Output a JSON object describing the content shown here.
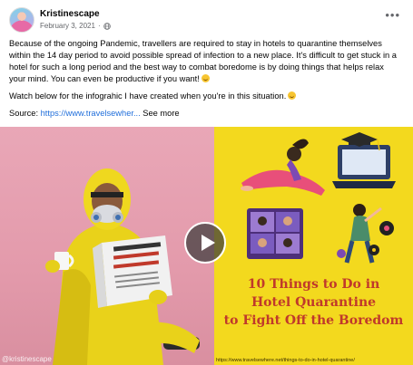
{
  "post": {
    "author": "Kristinescape",
    "date": "February 3, 2021",
    "dot": "·",
    "more_icon": "more-horizontal-icon",
    "body": {
      "paragraph1": "Because of  the ongoing Pandemic, travellers are required to stay in hotels to quarantine themselves within the 14 day period to avoid possible spread of infection to a new place. It's difficult to get stuck in a hotel for such a long period and the best way to combat boredome is by doing things that helps relax your mind. You can even be productive if you want!",
      "paragraph2": "Watch below for the infograhic I have created when you're in this situation.",
      "source_label": "Source:",
      "source_link": "https://www.travelsewher...",
      "see_more": "See more"
    }
  },
  "media": {
    "watermark": "@kristinescape",
    "url_caption": "https://www.travelsewhere.net/things-to-do-in-hotel-quarantine/",
    "headline_line1": "10 Things to Do in",
    "headline_line2": "Hotel Quarantine",
    "headline_line3": "to Fight Off the Boredom",
    "play_icon": "play-icon"
  },
  "colors": {
    "link": "#216fdb",
    "infographic_bg": "#f3d91e",
    "headline": "#c0392b",
    "photo_bg": "#e39aab"
  }
}
